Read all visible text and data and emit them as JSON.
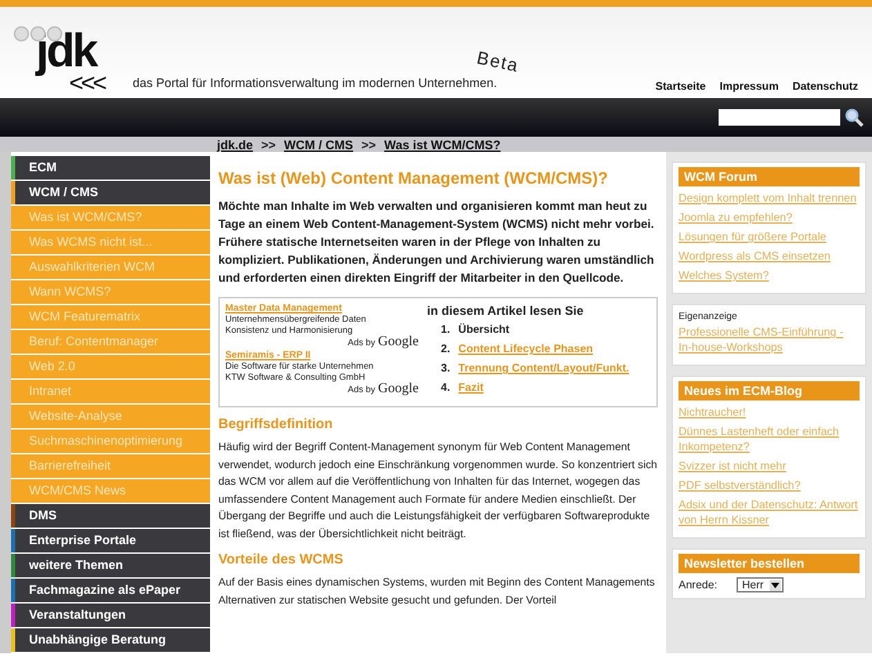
{
  "logo": {
    "name": "jdk",
    "arrows": "<<<"
  },
  "tagline": "das Portal für Informationsverwaltung im modernen Unternehmen.",
  "beta": "Beta",
  "top_links": [
    "Startseite",
    "Impressum",
    "Datenschutz"
  ],
  "breadcrumb": [
    "jdk.de",
    ">>",
    "WCM / CMS",
    ">>",
    "Was ist WCM/CMS?"
  ],
  "sidebar": {
    "items": [
      {
        "label": "ECM",
        "kind": "section",
        "color": "#4caf50"
      },
      {
        "label": "WCM / CMS",
        "kind": "section",
        "color": "#f0a020"
      },
      {
        "label": "Was ist WCM/CMS?",
        "kind": "sub"
      },
      {
        "label": "Was WCMS nicht ist...",
        "kind": "sub"
      },
      {
        "label": "Auswahlkriterien WCM",
        "kind": "sub"
      },
      {
        "label": "Wann WCMS?",
        "kind": "sub"
      },
      {
        "label": "WCM Featurematrix",
        "kind": "sub"
      },
      {
        "label": "Beruf: Contentmanager",
        "kind": "sub"
      },
      {
        "label": "Web 2.0",
        "kind": "sub"
      },
      {
        "label": "Intranet",
        "kind": "sub"
      },
      {
        "label": "Website-Analyse",
        "kind": "sub"
      },
      {
        "label": "Suchmaschinenoptimierung",
        "kind": "sub"
      },
      {
        "label": "Barrierefreiheit",
        "kind": "sub"
      },
      {
        "label": "WCM/CMS News",
        "kind": "sub"
      },
      {
        "label": "DMS",
        "kind": "section",
        "color": "#8b4513"
      },
      {
        "label": "Enterprise Portale",
        "kind": "section",
        "color": "#1e6fb0"
      },
      {
        "label": "weitere Themen",
        "kind": "section",
        "color": "#2e8b3e"
      },
      {
        "label": "Fachmagazine als ePaper",
        "kind": "section",
        "color": "#1e6fb0"
      },
      {
        "label": "Veranstaltungen",
        "kind": "section",
        "color": "#c020c0"
      },
      {
        "label": "Unabhängige Beratung",
        "kind": "section",
        "color": "#e8c020"
      }
    ]
  },
  "article": {
    "title": "Was ist (Web) Content Management (WCM/CMS)?",
    "intro": "Möchte man Inhalte im Web verwalten und organisieren kommt man heut zu Tage an einem Web Content-Management-System (WCMS) nicht mehr vorbei. Frühere statische Internetseiten waren in der Pflege von Inhalten zu kompliziert. Publikationen, Änderungen und Archivierung waren umständlich und erforderten einen direkten Eingriff der Mitarbeiter in den Quellcode.",
    "ads": [
      {
        "title": "Master Data Management",
        "lines": [
          "Unternehmensübergreifende Daten",
          "Konsistenz und Harmonisierung"
        ],
        "ads_by": "Ads by",
        "brand": "Google"
      },
      {
        "title": "Semiramis - ERP II",
        "lines": [
          "Die Software für starke Unternehmen",
          "KTW Software & Consulting GmbH"
        ],
        "ads_by": "Ads by",
        "brand": "Google"
      }
    ],
    "toc": {
      "heading": "in diesem Artikel lesen Sie",
      "items": [
        {
          "number": "1.",
          "label": "Übersicht",
          "kind": "text"
        },
        {
          "number": "2.",
          "label": "Content Lifecycle Phasen",
          "kind": "link"
        },
        {
          "number": "3.",
          "label": "Trennung Content/Layout/Funkt.",
          "kind": "link"
        },
        {
          "number": "4.",
          "label": "Fazit",
          "kind": "link"
        }
      ]
    },
    "sections": [
      {
        "heading": "Begriffsdefinition",
        "text": "Häufig wird der Begriff Content-Management synonym für Web Content Management verwendet, wodurch jedoch eine Einschränkung vorgenommen wurde. So konzentriert sich das WCM vor allem auf die Veröffentlichung von Inhalten für das Internet, wogegen das umfassendere Content Management auch Formate für andere Medien einschließt. Der Übergang der Begriffe und auch die Leistungsfähigkeit der verfügbaren Softwareprodukte ist fließend, was der Übersichtlichkeit nicht beiträgt."
      },
      {
        "heading": "Vorteile des WCMS",
        "text": "Auf der Basis eines dynamischen Systems, wurden mit Beginn des Content Managements Alternativen zur statischen Website gesucht und gefunden. Der Vorteil"
      }
    ]
  },
  "right": {
    "forum": {
      "title": "WCM Forum",
      "links": [
        "Design komplett vom Inhalt trennen",
        "Joomla zu empfehlen?",
        "Lösungen für größere Portale",
        "Wordpress als CMS einsetzen",
        "Welches System?"
      ]
    },
    "promo": {
      "label": "Eigenanzeige",
      "link": "Professionelle CMS-Einführung - In-house-Workshops"
    },
    "blog": {
      "title": "Neues im ECM-Blog",
      "links": [
        "Nichtraucher!",
        "Dünnes Lastenheft oder einfach Inkompetenz?",
        "Svizzer ist nicht mehr",
        "PDF selbstverständlich?",
        "Adsix und der Datenschutz: Antwort von Herrn Kissner"
      ]
    },
    "newsletter": {
      "title": "Newsletter bestellen",
      "field_label": "Anrede:",
      "value": "Herr"
    }
  }
}
